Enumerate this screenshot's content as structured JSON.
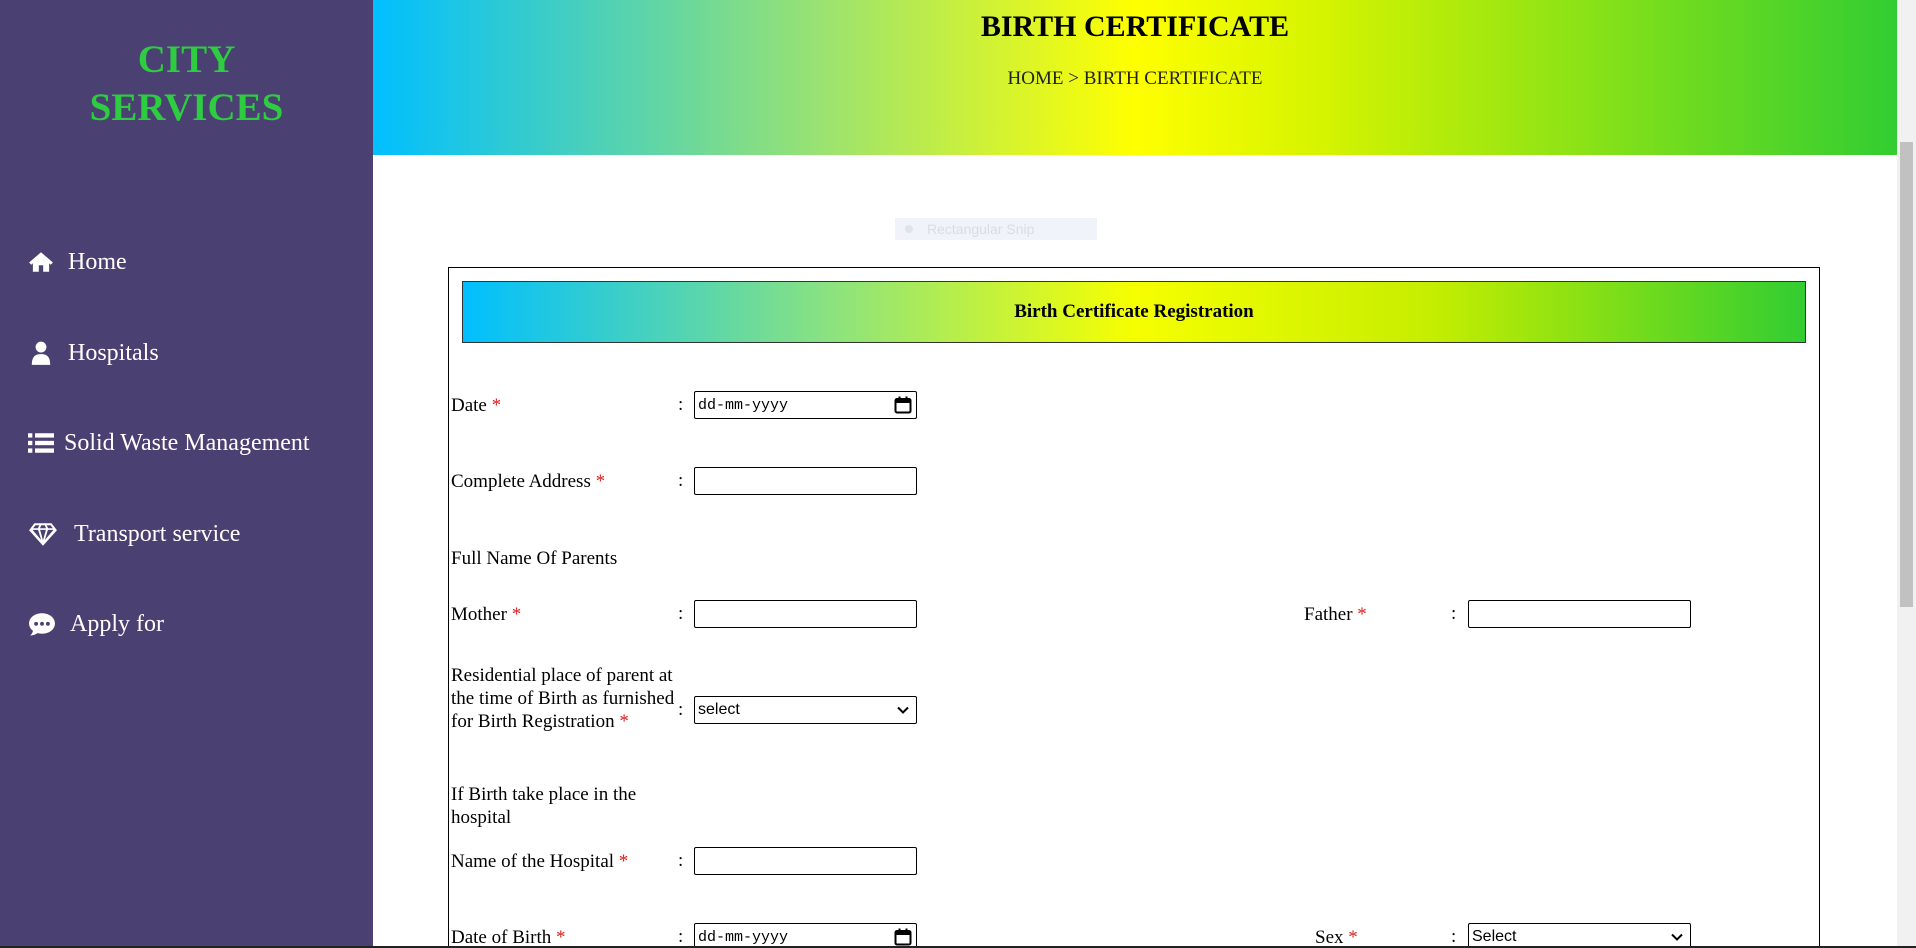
{
  "sidebar": {
    "brand_line1": "CITY",
    "brand_line2": "SERVICES",
    "items": [
      {
        "label": "Home",
        "icon": "home-icon"
      },
      {
        "label": "Hospitals",
        "icon": "user-icon"
      },
      {
        "label": "Solid Waste Management",
        "icon": "list-icon"
      },
      {
        "label": "Transport service",
        "icon": "diamond-icon"
      },
      {
        "label": "Apply for",
        "icon": "comment-icon"
      }
    ]
  },
  "header": {
    "title": "BIRTH CERTIFICATE",
    "breadcrumb": {
      "home": "HOME",
      "sep": " > ",
      "current": "BIRTH CERTIFICATE"
    }
  },
  "overlay": {
    "snip_label": "Rectangular Snip"
  },
  "form": {
    "heading": "Birth Certificate Registration",
    "required_mark": "*",
    "colon": ":",
    "date": {
      "label": "Date ",
      "value": "dd-mm-yyyy"
    },
    "address": {
      "label": "Complete Address ",
      "value": ""
    },
    "parents_heading": "Full Name Of Parents",
    "mother": {
      "label": "Mother ",
      "value": ""
    },
    "father": {
      "label": "Father ",
      "value": ""
    },
    "residential": {
      "label": "Residential place of parent at the time of Birth as furnished for Birth Registration ",
      "value": "select"
    },
    "hospital_heading": "If Birth take place in the hospital",
    "hospital": {
      "label": "Name of the Hospital ",
      "value": ""
    },
    "dob": {
      "label": "Date of Birth ",
      "value": "dd-mm-yyyy"
    },
    "sex": {
      "label": "Sex ",
      "value": "Select"
    }
  },
  "colors": {
    "sidebar_bg": "#4a4172",
    "brand": "#2ecc40",
    "required": "#e02020",
    "gradient_start": "#00bfff",
    "gradient_mid": "#ffff00",
    "gradient_end": "#32cd32"
  }
}
